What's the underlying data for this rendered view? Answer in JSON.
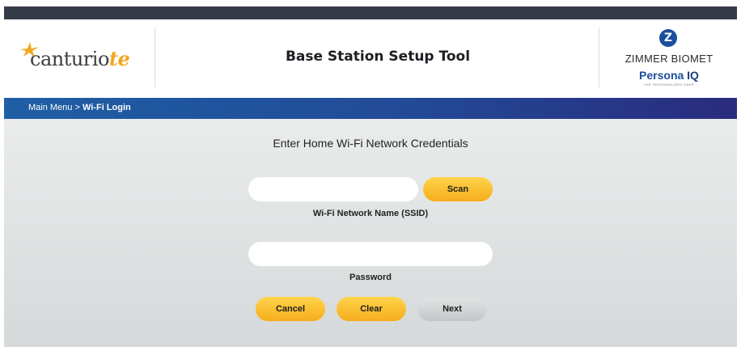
{
  "header": {
    "brand_left_main": "canturio",
    "brand_left_suffix": "te",
    "title": "Base Station Setup Tool",
    "brand_right_company": "ZIMMER BIOMET",
    "brand_right_product": "Persona",
    "brand_right_product_suffix": "IQ",
    "brand_right_tagline": "THE PERSONALIZED KNEE"
  },
  "breadcrumb": {
    "parent": "Main Menu",
    "separator": " > ",
    "current": "Wi-Fi Login"
  },
  "form": {
    "heading": "Enter Home Wi-Fi Network Credentials",
    "ssid_value": "",
    "ssid_label": "Wi-Fi Network Name (SSID)",
    "password_value": "",
    "password_label": "Password"
  },
  "buttons": {
    "scan": "Scan",
    "cancel": "Cancel",
    "clear": "Clear",
    "next": "Next"
  },
  "colors": {
    "accent_yellow": "#f6ad1c",
    "nav_blue": "#224a97",
    "top_bar": "#353a47",
    "brand_blue": "#1a4f9c"
  }
}
